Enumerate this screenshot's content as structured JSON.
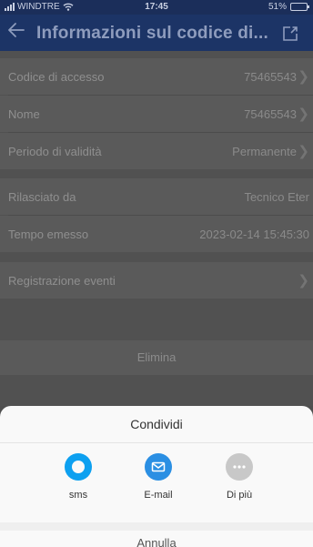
{
  "status_bar": {
    "carrier": "WINDTRE",
    "time": "17:45",
    "battery": "51%",
    "battery_level": 0.51
  },
  "nav": {
    "title": "Informazioni sul  codice di...",
    "back_icon": "arrow-left-icon",
    "share_icon": "export-icon"
  },
  "details": {
    "access_code": {
      "label": "Codice di accesso",
      "value": "75465543"
    },
    "name": {
      "label": "Nome",
      "value": "75465543"
    },
    "validity": {
      "label": "Periodo di validità",
      "value": "Permanente"
    },
    "issued_by": {
      "label": "Rilasciato da",
      "value": "Tecnico Eter"
    },
    "issued_time": {
      "label": "Tempo emesso",
      "value": "2023-02-14 15:45:30"
    },
    "event_log": {
      "label": "Registrazione eventi"
    }
  },
  "delete_label": "Elimina",
  "share_sheet": {
    "title": "Condividi",
    "options": [
      {
        "label": "sms",
        "icon": "sms-icon",
        "color": "#0da0f0"
      },
      {
        "label": "E-mail",
        "icon": "email-icon",
        "color": "#2b8fe3"
      },
      {
        "label": "Di più",
        "icon": "more-icon",
        "color": "#c8c8c8"
      }
    ],
    "cancel_label": "Annulla"
  }
}
